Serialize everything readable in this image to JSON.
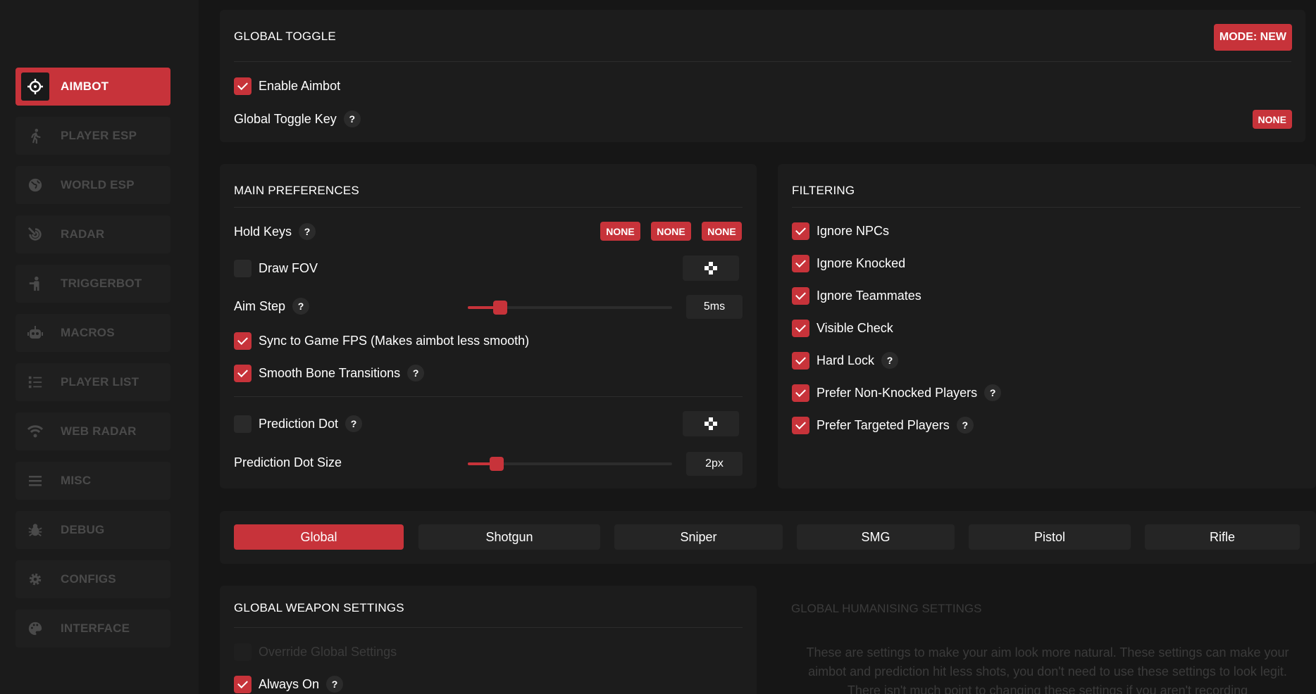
{
  "sidebar": {
    "items": [
      {
        "label": "AIMBOT",
        "icon": "crosshair-icon",
        "active": true
      },
      {
        "label": "PLAYER ESP",
        "icon": "running-person-icon"
      },
      {
        "label": "WORLD ESP",
        "icon": "globe-icon"
      },
      {
        "label": "RADAR",
        "icon": "radar-icon"
      },
      {
        "label": "TRIGGERBOT",
        "icon": "soldier-icon"
      },
      {
        "label": "MACROS",
        "icon": "robot-icon"
      },
      {
        "label": "PLAYER LIST",
        "icon": "list-icon"
      },
      {
        "label": "WEB RADAR",
        "icon": "wifi-icon"
      },
      {
        "label": "MISC",
        "icon": "menu-icon"
      },
      {
        "label": "DEBUG",
        "icon": "bug-icon"
      },
      {
        "label": "CONFIGS",
        "icon": "gear-icon"
      },
      {
        "label": "INTERFACE",
        "icon": "palette-icon"
      }
    ]
  },
  "global_toggle": {
    "title": "GLOBAL TOGGLE",
    "mode_label": "MODE: NEW",
    "enable_label": "Enable Aimbot",
    "enable_checked": true,
    "toggle_key_label": "Global Toggle Key",
    "toggle_key_value": "NONE"
  },
  "main_preferences": {
    "title": "MAIN PREFERENCES",
    "hold_keys_label": "Hold Keys",
    "hold_keys": [
      "NONE",
      "NONE",
      "NONE"
    ],
    "draw_fov_label": "Draw FOV",
    "draw_fov_checked": false,
    "aim_step_label": "Aim Step",
    "aim_step_value": "5ms",
    "aim_step_fraction": 0.16,
    "sync_fps_label": "Sync to Game FPS (Makes aimbot less smooth)",
    "sync_fps_checked": true,
    "smooth_bone_label": "Smooth Bone Transitions",
    "smooth_bone_checked": true,
    "prediction_dot_label": "Prediction Dot",
    "prediction_dot_checked": false,
    "prediction_dot_size_label": "Prediction Dot Size",
    "prediction_dot_size_value": "2px",
    "prediction_dot_size_fraction": 0.14
  },
  "filtering": {
    "title": "FILTERING",
    "items": [
      {
        "label": "Ignore NPCs",
        "checked": true,
        "help": false
      },
      {
        "label": "Ignore Knocked",
        "checked": true,
        "help": false
      },
      {
        "label": "Ignore Teammates",
        "checked": true,
        "help": false
      },
      {
        "label": "Visible Check",
        "checked": true,
        "help": false
      },
      {
        "label": "Hard Lock",
        "checked": true,
        "help": true
      },
      {
        "label": "Prefer Non-Knocked Players",
        "checked": true,
        "help": true
      },
      {
        "label": "Prefer Targeted Players",
        "checked": true,
        "help": true
      }
    ]
  },
  "weapon_tabs": {
    "tabs": [
      "Global",
      "Shotgun",
      "Sniper",
      "SMG",
      "Pistol",
      "Rifle"
    ],
    "active": "Global"
  },
  "weapon_settings": {
    "title": "GLOBAL WEAPON SETTINGS",
    "override_label": "Override Global Settings",
    "always_on_label": "Always On",
    "always_on_checked": true
  },
  "humanising": {
    "title": "GLOBAL HUMANISING SETTINGS",
    "description": "These are settings to make your aim look more natural. These settings can make your aimbot and prediction hit less shots, you don't need to use these settings to look legit. There isn't much point to changing these settings if you aren't recording"
  },
  "help_glyph": "?",
  "colors": {
    "accent": "#c7333a",
    "panel": "#1c1c1c",
    "background": "#161616"
  }
}
